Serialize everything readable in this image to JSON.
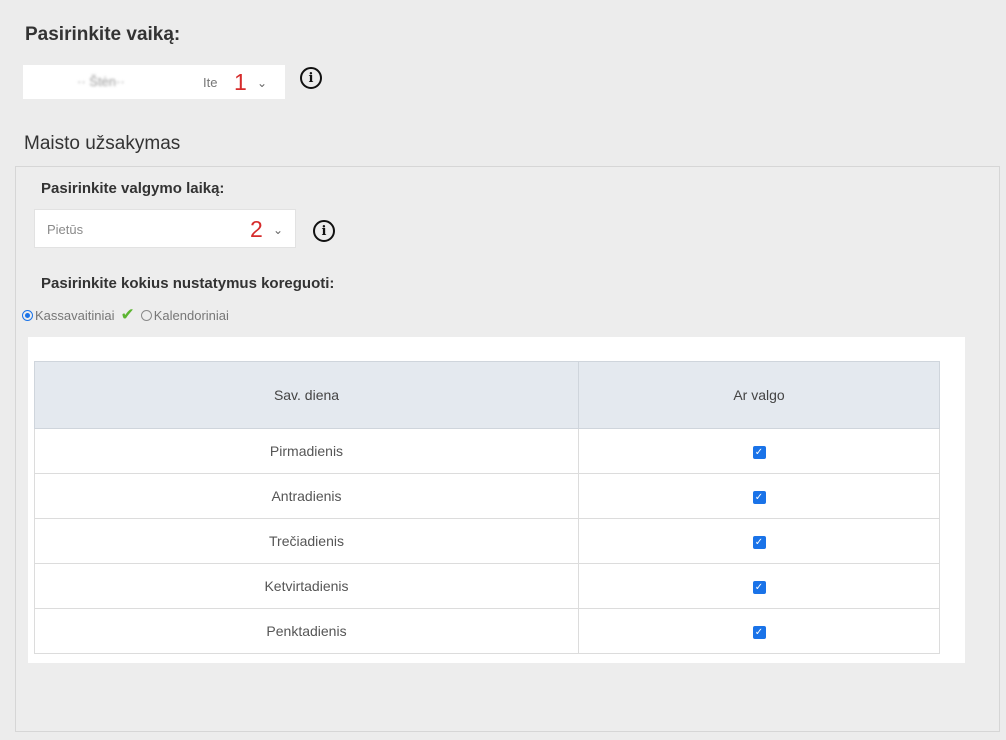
{
  "child": {
    "label": "Pasirinkite vaiką:",
    "value_blurred": "·· Štėn··",
    "value_tail": "Ite",
    "marker": "1"
  },
  "section_title": "Maisto užsakymas",
  "meal": {
    "label": "Pasirinkite valgymo laiką:",
    "value": "Pietūs",
    "marker": "2"
  },
  "settings": {
    "label": "Pasirinkite kokius nustatymus koreguoti:",
    "options": [
      {
        "label": "Kassavaitiniai",
        "selected": true
      },
      {
        "label": "Kalendoriniai",
        "selected": false
      }
    ]
  },
  "table": {
    "headers": [
      "Sav. diena",
      "Ar valgo"
    ],
    "rows": [
      {
        "day": "Pirmadienis",
        "eats": true
      },
      {
        "day": "Antradienis",
        "eats": true
      },
      {
        "day": "Trečiadienis",
        "eats": true
      },
      {
        "day": "Ketvirtadienis",
        "eats": true
      },
      {
        "day": "Penktadienis",
        "eats": true
      }
    ]
  },
  "colors": {
    "accent": "#1a73e8",
    "marker": "#d62b2b",
    "check": "#5cb531"
  }
}
